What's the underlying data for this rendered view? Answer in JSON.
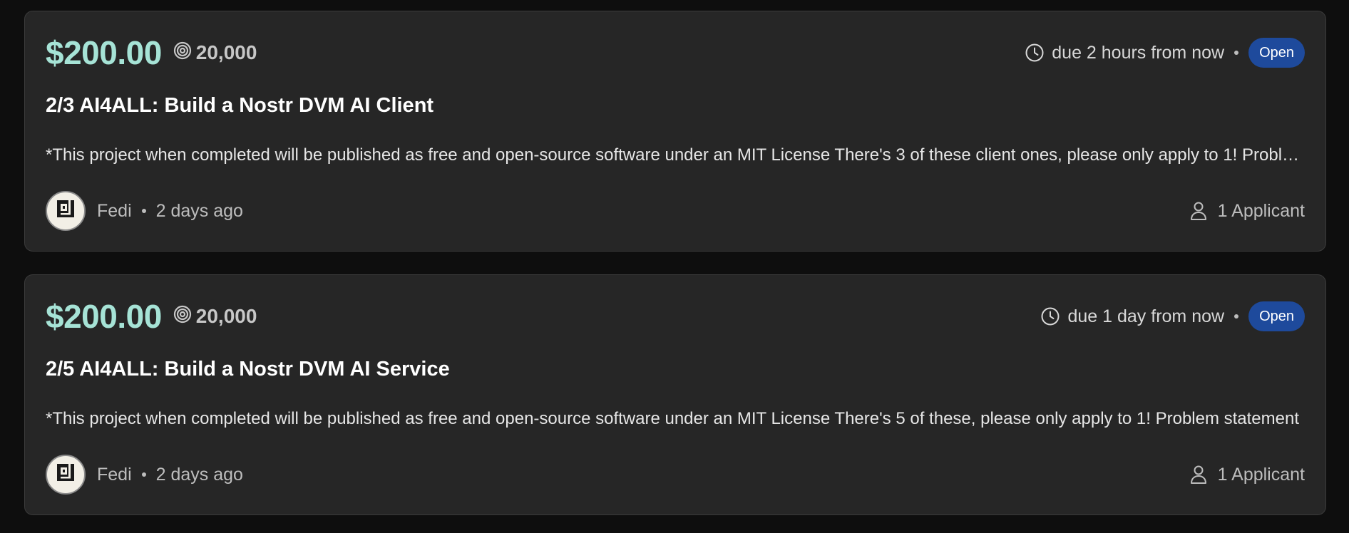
{
  "bounties": [
    {
      "usd": "$200.00",
      "sats": "20,000",
      "due": "due 2 hours from now",
      "status": "Open",
      "title": "2/3 AI4ALL: Build a Nostr DVM AI Client",
      "description": "*This project when completed will be published as free and open-source software under an MIT License There's 3 of these client ones, please only apply to 1! Problem",
      "author": "Fedi",
      "posted": "2 days ago",
      "applicants": "1 Applicant"
    },
    {
      "usd": "$200.00",
      "sats": "20,000",
      "due": "due 1 day from now",
      "status": "Open",
      "title": "2/5 AI4ALL: Build a Nostr DVM AI Service",
      "description": "*This project when completed will be published as free and open-source software under an MIT License There's 5 of these, please only apply to 1! Problem statement",
      "author": "Fedi",
      "posted": "2 days ago",
      "applicants": "1 Applicant"
    }
  ],
  "icons": {
    "sats": "sats-spiral-icon",
    "due": "clock-icon",
    "applicants": "person-icon",
    "avatar": "fedi-logo-icon"
  },
  "colors": {
    "usd": "#a6e3d6",
    "badge": "#1e4a9c",
    "card": "#262626",
    "background": "#0e0e0e"
  }
}
